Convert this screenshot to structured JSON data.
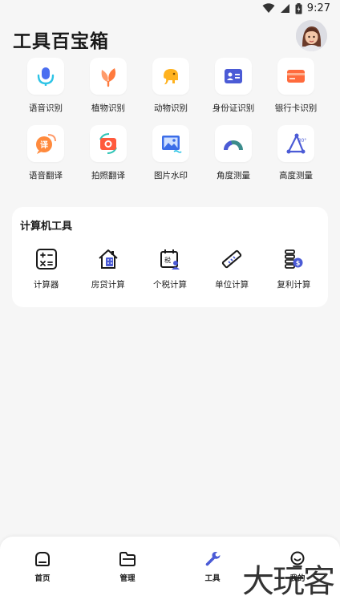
{
  "status": {
    "time": "9:27"
  },
  "header": {
    "title": "工具百宝箱"
  },
  "tools": [
    {
      "label": "语音识别",
      "icon": "microphone-icon"
    },
    {
      "label": "植物识别",
      "icon": "leaf-icon"
    },
    {
      "label": "动物识别",
      "icon": "elephant-icon"
    },
    {
      "label": "身份证识别",
      "icon": "id-card-icon"
    },
    {
      "label": "银行卡识别",
      "icon": "bank-card-icon"
    },
    {
      "label": "语音翻译",
      "icon": "speech-translate-icon"
    },
    {
      "label": "拍照翻译",
      "icon": "camera-translate-icon"
    },
    {
      "label": "图片水印",
      "icon": "image-watermark-icon"
    },
    {
      "label": "角度测量",
      "icon": "protractor-icon"
    },
    {
      "label": "高度测量",
      "icon": "height-measure-icon"
    }
  ],
  "calc_section": {
    "title": "计算机工具",
    "items": [
      {
        "label": "计算器",
        "icon": "calculator-icon"
      },
      {
        "label": "房贷计算",
        "icon": "house-loan-icon"
      },
      {
        "label": "个税计算",
        "icon": "tax-calendar-icon"
      },
      {
        "label": "单位计算",
        "icon": "ruler-icon"
      },
      {
        "label": "复利计算",
        "icon": "coin-stack-icon"
      }
    ],
    "tax_glyph": "税",
    "angle_glyph": "30°"
  },
  "nav": [
    {
      "label": "首页",
      "icon": "home-icon"
    },
    {
      "label": "管理",
      "icon": "folder-icon"
    },
    {
      "label": "工具",
      "icon": "wrench-icon"
    },
    {
      "label": "我的",
      "icon": "profile-icon"
    }
  ],
  "watermark": {
    "text": "大玩客"
  },
  "colors": {
    "accent": "#4b5bd6",
    "orange": "#ff7a3d",
    "blue": "#3b6de8",
    "background": "#f6f6f6"
  }
}
